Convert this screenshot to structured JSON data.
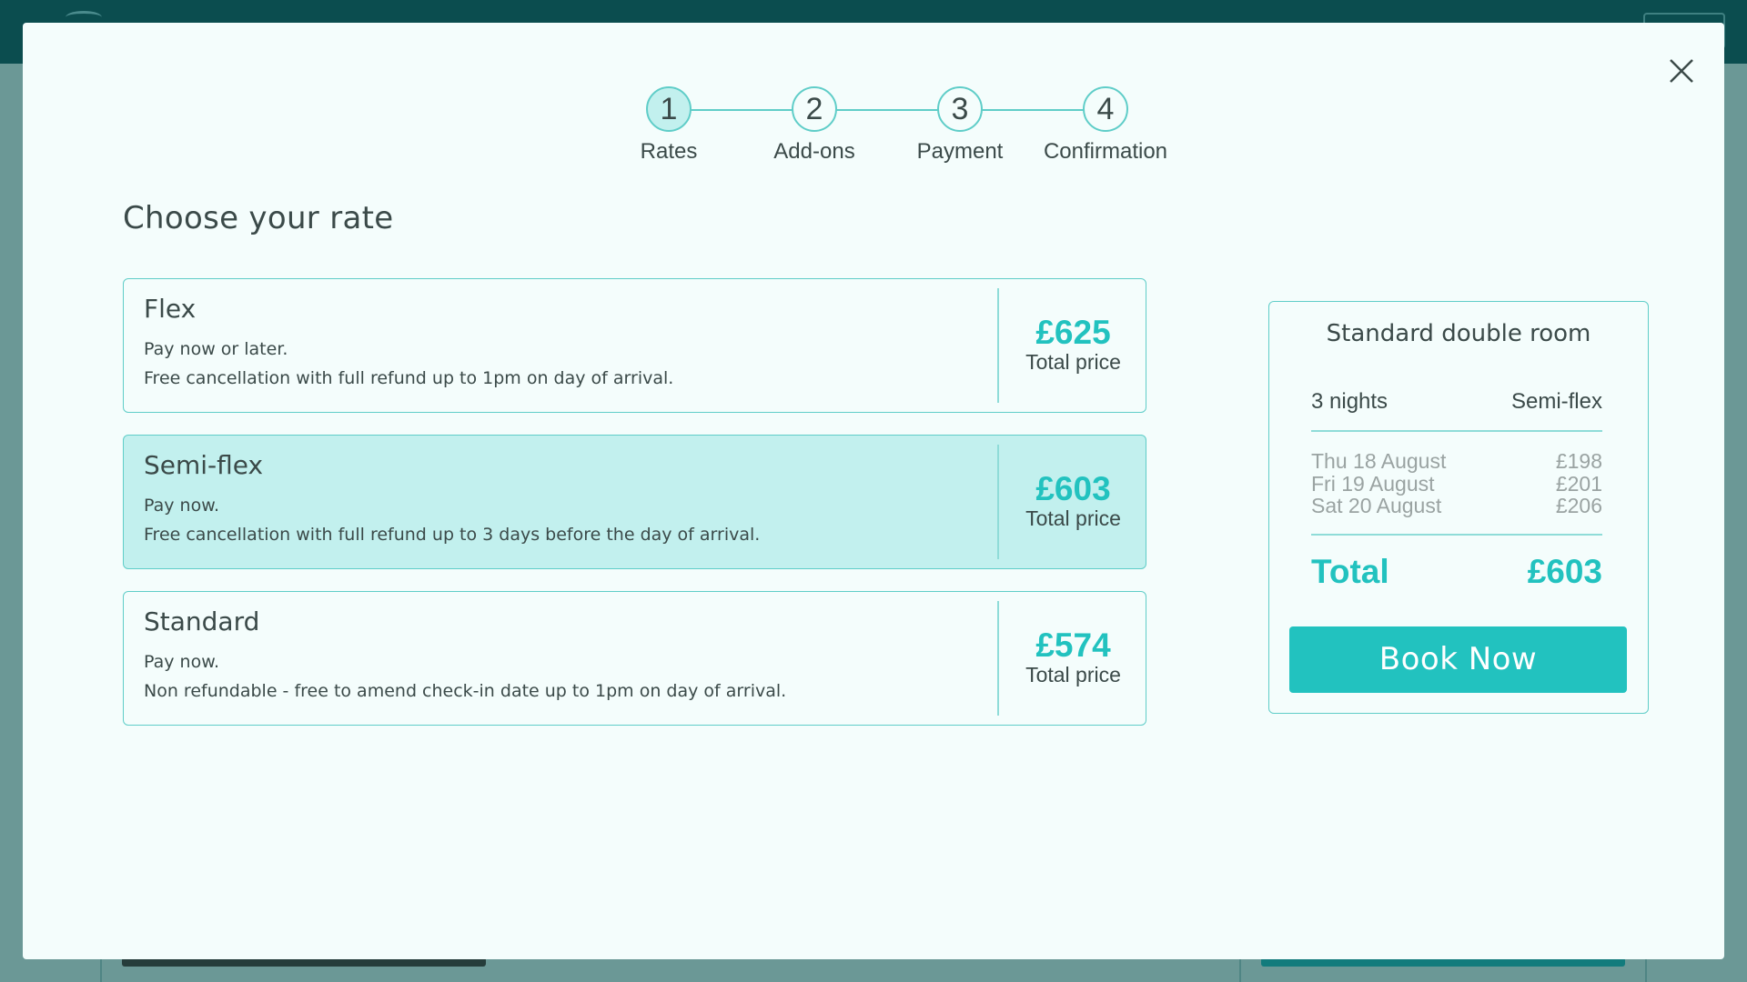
{
  "steps": [
    {
      "number": "1",
      "label": "Rates"
    },
    {
      "number": "2",
      "label": "Add-ons"
    },
    {
      "number": "3",
      "label": "Payment"
    },
    {
      "number": "4",
      "label": "Confirmation"
    }
  ],
  "heading": "Choose your rate",
  "rates": [
    {
      "title": "Flex",
      "line1": "Pay now or later.",
      "line2": "Free cancellation with full refund up to 1pm on day of arrival.",
      "price": "£625",
      "price_label": "Total price"
    },
    {
      "title": "Semi-flex",
      "line1": "Pay now.",
      "line2": "Free cancellation with full refund up to 3 days before the day of arrival.",
      "price": "£603",
      "price_label": "Total price"
    },
    {
      "title": "Standard",
      "line1": "Pay now.",
      "line2": "Non refundable - free to amend check-in date up to 1pm on day of arrival.",
      "price": "£574",
      "price_label": "Total price"
    }
  ],
  "summary": {
    "room_title": "Standard double room",
    "nights": "3 nights",
    "rate": "Semi-flex",
    "night_lines": [
      {
        "date": "Thu 18 August",
        "price": "£198"
      },
      {
        "date": "Fri 19 August",
        "price": "£201"
      },
      {
        "date": "Sat 20 August",
        "price": "£206"
      }
    ],
    "total_label": "Total",
    "total_value": "£603",
    "book_button": "Book Now"
  },
  "colors": {
    "accent": "#22c2bf",
    "selected_bg": "#c2f0ee",
    "header_bg": "#0b4d4f"
  },
  "icons": {
    "close": "close-icon"
  }
}
